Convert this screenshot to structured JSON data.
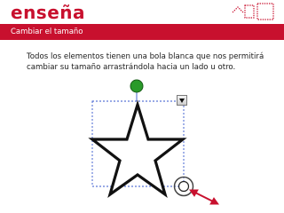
{
  "header": {
    "app_title": "enseña",
    "logo_icon": "pixel-window-logo-icon",
    "brand_color": "#c8102e"
  },
  "section": {
    "title": "Cambiar el tamaño"
  },
  "main": {
    "description": "Todos los elementos tienen una bola blanca que nos permitirá cambiar su tamaño arrastrándola hacia un lado u otro."
  },
  "canvas": {
    "shape_icon": "star-icon",
    "rotate_handle_icon": "green-rotation-handle-icon",
    "resize_handle_icon": "white-resize-handle-icon",
    "menu_icon": "dropdown-arrow-icon",
    "pointer_icon": "red-double-arrow-icon",
    "selection_color": "#3355cc",
    "rotate_handle_color": "#2a9a2a",
    "arrow_color": "#c8102e"
  }
}
